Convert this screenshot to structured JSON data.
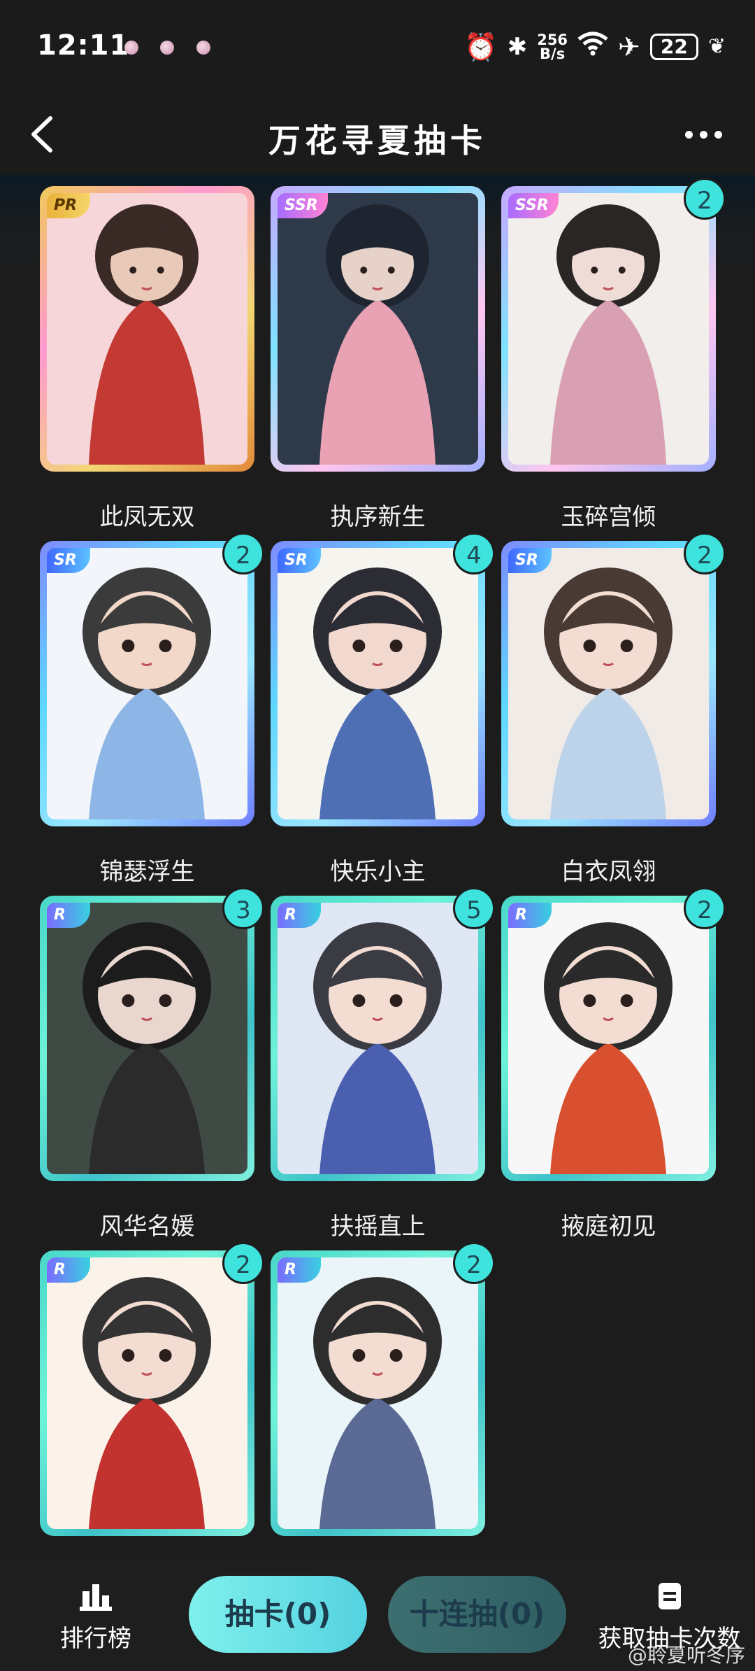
{
  "status_bar": {
    "time": "12:11",
    "net_speed_value": "256",
    "net_speed_unit": "B/s",
    "battery": "22",
    "icons": [
      "alarm-icon",
      "bluetooth-icon",
      "wifi-icon",
      "airplane-icon",
      "battery-icon",
      "leaf-icon"
    ]
  },
  "header": {
    "title": "万花寻夏抽卡",
    "back_icon": "chevron-left-icon",
    "more_icon": "more-dots-icon"
  },
  "cards": [
    {
      "name": "此凤无双",
      "rarity": "PR",
      "count": null
    },
    {
      "name": "执序新生",
      "rarity": "SSR",
      "count": null
    },
    {
      "name": "玉碎宫倾",
      "rarity": "SSR",
      "count": "2"
    },
    {
      "name": "锦瑟浮生",
      "rarity": "SR",
      "count": "2"
    },
    {
      "name": "快乐小主",
      "rarity": "SR",
      "count": "4"
    },
    {
      "name": "白衣凤翎",
      "rarity": "SR",
      "count": "2"
    },
    {
      "name": "风华名媛",
      "rarity": "R",
      "count": "3"
    },
    {
      "name": "扶摇直上",
      "rarity": "R",
      "count": "5"
    },
    {
      "name": "掖庭初见",
      "rarity": "R",
      "count": "2"
    },
    {
      "name": "",
      "rarity": "R",
      "count": "2"
    },
    {
      "name": "",
      "rarity": "R",
      "count": "2"
    }
  ],
  "bottom_bar": {
    "ranking_label": "排行榜",
    "draw_label": "抽卡(0)",
    "ten_draw_label": "十连抽(0)",
    "get_draws_label": "获取抽卡次数"
  },
  "watermark": "@聆夏听冬序",
  "colors": {
    "background": "#1c1c1d",
    "accent_cyan": "#3fe3dd",
    "draw_button": "#6fe6e6",
    "ten_draw_button": "#3a6a6c"
  }
}
